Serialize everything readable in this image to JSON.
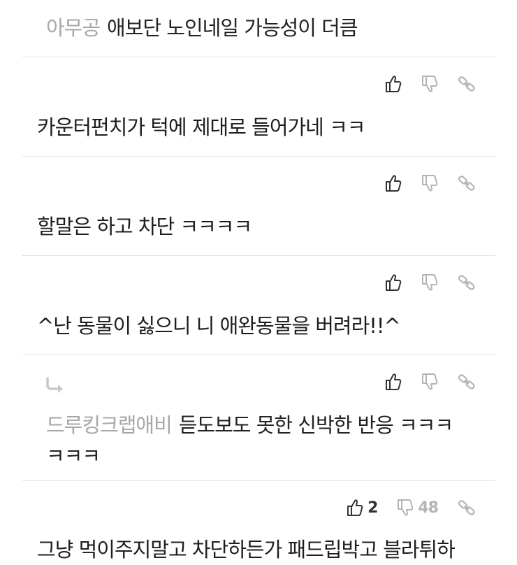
{
  "comments": [
    {
      "nick": "아무공",
      "text": "애보단 노인네일 가능성이 더큼"
    },
    {
      "text": "카운터펀치가 턱에 제대로 들어가네 ㅋㅋ"
    },
    {
      "text": "할말은 하고 차단 ㅋㅋㅋㅋ"
    },
    {
      "text": "^난 동물이 싫으니 니 애완동물을 버려라!!^"
    },
    {
      "nick": "드루킹크랩애비",
      "text": "듣도보도 못한 신박한 반응 ㅋㅋㅋ ㅋㅋㅋ"
    },
    {
      "text": "그냥 먹이주지말고 차단하든가 패드립박고 블라튀하"
    }
  ],
  "votes": {
    "up_count": "2",
    "down_count": "48"
  },
  "icons": [
    "thumbs-up-icon",
    "thumbs-down-icon",
    "link-icon",
    "reply-arrow-icon"
  ],
  "colors": {
    "nick": "#a7a7a7",
    "divider": "#e3e3e3",
    "icon_active": "#333333",
    "icon_muted": "#b4b4b4"
  }
}
